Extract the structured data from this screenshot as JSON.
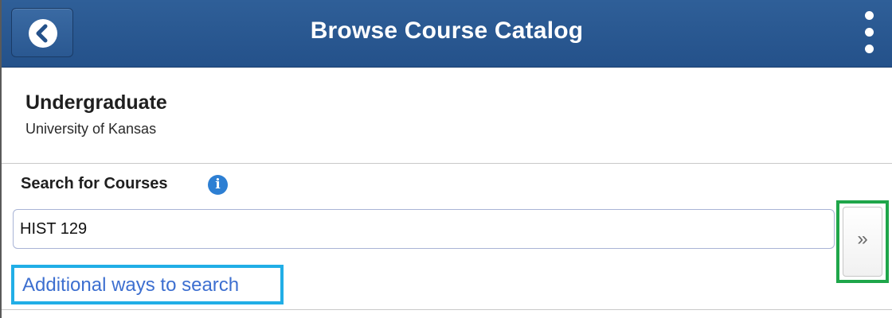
{
  "header": {
    "title": "Browse Course Catalog",
    "back_icon": "chevron-left-icon",
    "menu_icon": "vertical-ellipsis-icon",
    "color": "#2f5f98"
  },
  "institution": {
    "career": "Undergraduate",
    "school": "University of Kansas"
  },
  "search": {
    "label": "Search for Courses",
    "info_icon": "info-icon",
    "value": "HIST 129",
    "go_label": "»",
    "additional_link": "Additional ways to search"
  },
  "highlights": {
    "go_button_color": "#1fa64a",
    "additional_link_color": "#21aee6"
  }
}
